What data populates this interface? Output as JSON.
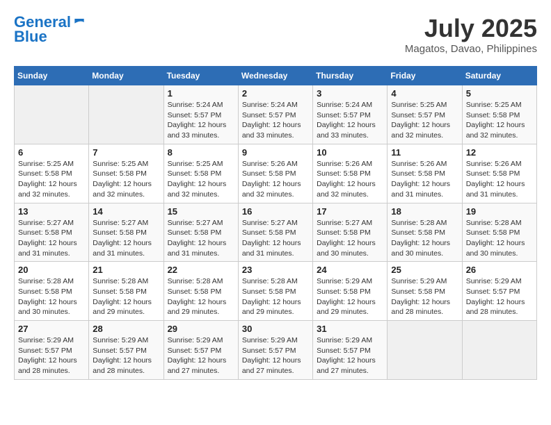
{
  "header": {
    "logo_line1": "General",
    "logo_line2": "Blue",
    "month_year": "July 2025",
    "location": "Magatos, Davao, Philippines"
  },
  "weekdays": [
    "Sunday",
    "Monday",
    "Tuesday",
    "Wednesday",
    "Thursday",
    "Friday",
    "Saturday"
  ],
  "weeks": [
    [
      {
        "day": "",
        "sunrise": "",
        "sunset": "",
        "daylight": ""
      },
      {
        "day": "",
        "sunrise": "",
        "sunset": "",
        "daylight": ""
      },
      {
        "day": "1",
        "sunrise": "Sunrise: 5:24 AM",
        "sunset": "Sunset: 5:57 PM",
        "daylight": "Daylight: 12 hours and 33 minutes."
      },
      {
        "day": "2",
        "sunrise": "Sunrise: 5:24 AM",
        "sunset": "Sunset: 5:57 PM",
        "daylight": "Daylight: 12 hours and 33 minutes."
      },
      {
        "day": "3",
        "sunrise": "Sunrise: 5:24 AM",
        "sunset": "Sunset: 5:57 PM",
        "daylight": "Daylight: 12 hours and 33 minutes."
      },
      {
        "day": "4",
        "sunrise": "Sunrise: 5:25 AM",
        "sunset": "Sunset: 5:57 PM",
        "daylight": "Daylight: 12 hours and 32 minutes."
      },
      {
        "day": "5",
        "sunrise": "Sunrise: 5:25 AM",
        "sunset": "Sunset: 5:58 PM",
        "daylight": "Daylight: 12 hours and 32 minutes."
      }
    ],
    [
      {
        "day": "6",
        "sunrise": "Sunrise: 5:25 AM",
        "sunset": "Sunset: 5:58 PM",
        "daylight": "Daylight: 12 hours and 32 minutes."
      },
      {
        "day": "7",
        "sunrise": "Sunrise: 5:25 AM",
        "sunset": "Sunset: 5:58 PM",
        "daylight": "Daylight: 12 hours and 32 minutes."
      },
      {
        "day": "8",
        "sunrise": "Sunrise: 5:25 AM",
        "sunset": "Sunset: 5:58 PM",
        "daylight": "Daylight: 12 hours and 32 minutes."
      },
      {
        "day": "9",
        "sunrise": "Sunrise: 5:26 AM",
        "sunset": "Sunset: 5:58 PM",
        "daylight": "Daylight: 12 hours and 32 minutes."
      },
      {
        "day": "10",
        "sunrise": "Sunrise: 5:26 AM",
        "sunset": "Sunset: 5:58 PM",
        "daylight": "Daylight: 12 hours and 32 minutes."
      },
      {
        "day": "11",
        "sunrise": "Sunrise: 5:26 AM",
        "sunset": "Sunset: 5:58 PM",
        "daylight": "Daylight: 12 hours and 31 minutes."
      },
      {
        "day": "12",
        "sunrise": "Sunrise: 5:26 AM",
        "sunset": "Sunset: 5:58 PM",
        "daylight": "Daylight: 12 hours and 31 minutes."
      }
    ],
    [
      {
        "day": "13",
        "sunrise": "Sunrise: 5:27 AM",
        "sunset": "Sunset: 5:58 PM",
        "daylight": "Daylight: 12 hours and 31 minutes."
      },
      {
        "day": "14",
        "sunrise": "Sunrise: 5:27 AM",
        "sunset": "Sunset: 5:58 PM",
        "daylight": "Daylight: 12 hours and 31 minutes."
      },
      {
        "day": "15",
        "sunrise": "Sunrise: 5:27 AM",
        "sunset": "Sunset: 5:58 PM",
        "daylight": "Daylight: 12 hours and 31 minutes."
      },
      {
        "day": "16",
        "sunrise": "Sunrise: 5:27 AM",
        "sunset": "Sunset: 5:58 PM",
        "daylight": "Daylight: 12 hours and 31 minutes."
      },
      {
        "day": "17",
        "sunrise": "Sunrise: 5:27 AM",
        "sunset": "Sunset: 5:58 PM",
        "daylight": "Daylight: 12 hours and 30 minutes."
      },
      {
        "day": "18",
        "sunrise": "Sunrise: 5:28 AM",
        "sunset": "Sunset: 5:58 PM",
        "daylight": "Daylight: 12 hours and 30 minutes."
      },
      {
        "day": "19",
        "sunrise": "Sunrise: 5:28 AM",
        "sunset": "Sunset: 5:58 PM",
        "daylight": "Daylight: 12 hours and 30 minutes."
      }
    ],
    [
      {
        "day": "20",
        "sunrise": "Sunrise: 5:28 AM",
        "sunset": "Sunset: 5:58 PM",
        "daylight": "Daylight: 12 hours and 30 minutes."
      },
      {
        "day": "21",
        "sunrise": "Sunrise: 5:28 AM",
        "sunset": "Sunset: 5:58 PM",
        "daylight": "Daylight: 12 hours and 29 minutes."
      },
      {
        "day": "22",
        "sunrise": "Sunrise: 5:28 AM",
        "sunset": "Sunset: 5:58 PM",
        "daylight": "Daylight: 12 hours and 29 minutes."
      },
      {
        "day": "23",
        "sunrise": "Sunrise: 5:28 AM",
        "sunset": "Sunset: 5:58 PM",
        "daylight": "Daylight: 12 hours and 29 minutes."
      },
      {
        "day": "24",
        "sunrise": "Sunrise: 5:29 AM",
        "sunset": "Sunset: 5:58 PM",
        "daylight": "Daylight: 12 hours and 29 minutes."
      },
      {
        "day": "25",
        "sunrise": "Sunrise: 5:29 AM",
        "sunset": "Sunset: 5:58 PM",
        "daylight": "Daylight: 12 hours and 28 minutes."
      },
      {
        "day": "26",
        "sunrise": "Sunrise: 5:29 AM",
        "sunset": "Sunset: 5:57 PM",
        "daylight": "Daylight: 12 hours and 28 minutes."
      }
    ],
    [
      {
        "day": "27",
        "sunrise": "Sunrise: 5:29 AM",
        "sunset": "Sunset: 5:57 PM",
        "daylight": "Daylight: 12 hours and 28 minutes."
      },
      {
        "day": "28",
        "sunrise": "Sunrise: 5:29 AM",
        "sunset": "Sunset: 5:57 PM",
        "daylight": "Daylight: 12 hours and 28 minutes."
      },
      {
        "day": "29",
        "sunrise": "Sunrise: 5:29 AM",
        "sunset": "Sunset: 5:57 PM",
        "daylight": "Daylight: 12 hours and 27 minutes."
      },
      {
        "day": "30",
        "sunrise": "Sunrise: 5:29 AM",
        "sunset": "Sunset: 5:57 PM",
        "daylight": "Daylight: 12 hours and 27 minutes."
      },
      {
        "day": "31",
        "sunrise": "Sunrise: 5:29 AM",
        "sunset": "Sunset: 5:57 PM",
        "daylight": "Daylight: 12 hours and 27 minutes."
      },
      {
        "day": "",
        "sunrise": "",
        "sunset": "",
        "daylight": ""
      },
      {
        "day": "",
        "sunrise": "",
        "sunset": "",
        "daylight": ""
      }
    ]
  ]
}
